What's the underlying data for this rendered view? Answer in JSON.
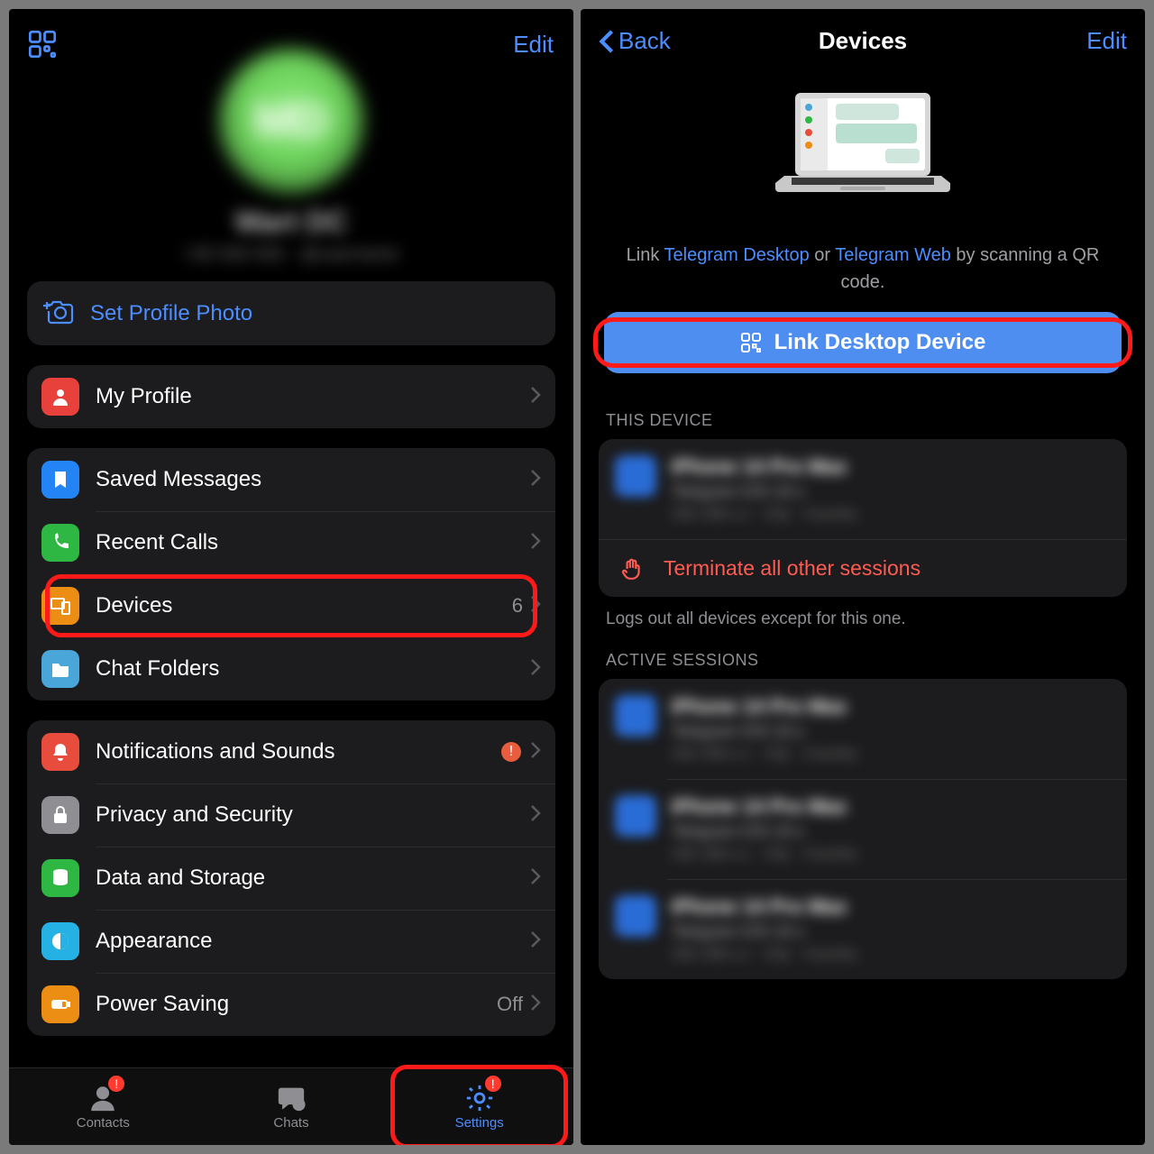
{
  "left": {
    "edit": "Edit",
    "avatar_initials": "MD",
    "profile_name": "Wart DC",
    "profile_sub": "+00 000 000 · @username",
    "set_photo": "Set Profile Photo",
    "my_profile": "My Profile",
    "group2": {
      "saved": "Saved Messages",
      "recent": "Recent Calls",
      "devices": "Devices",
      "devices_count": "6",
      "folders": "Chat Folders"
    },
    "group3": {
      "notif": "Notifications and Sounds",
      "notif_badge": "!",
      "privacy": "Privacy and Security",
      "data": "Data and Storage",
      "appearance": "Appearance",
      "power": "Power Saving",
      "power_value": "Off"
    },
    "tabs": {
      "contacts": "Contacts",
      "chats": "Chats",
      "settings": "Settings",
      "contacts_badge": "!",
      "settings_badge": "!"
    }
  },
  "right": {
    "back": "Back",
    "title": "Devices",
    "edit": "Edit",
    "link_pre": "Link ",
    "link_desktop": "Telegram Desktop",
    "link_or": " or ",
    "link_web": "Telegram Web",
    "link_post": " by scanning a QR code.",
    "button": "Link Desktop Device",
    "section_this": "THIS DEVICE",
    "terminate": "Terminate all other sessions",
    "footer": "Logs out all devices except for this one.",
    "section_active": "ACTIVE SESSIONS",
    "device_placeholder": {
      "title": "iPhone 14 Pro Max",
      "sub": "Telegram iOS 10.x",
      "meta": "192.168.x.x · City · Country"
    }
  },
  "colors": {
    "accent": "#4c8dff",
    "danger": "#ff5b52",
    "row_bg": "#1c1c1e",
    "ring": "#ff1a1a"
  }
}
